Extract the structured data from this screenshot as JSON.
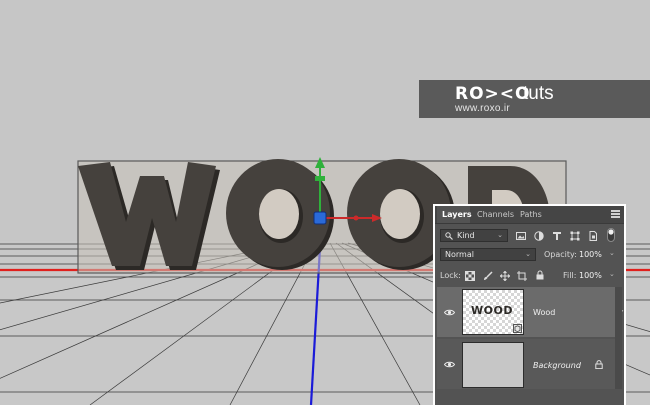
{
  "watermark": {
    "logo": "RO><O",
    "tuts": "tuts",
    "url": "www.roxo.ir"
  },
  "scene": {
    "text_3d": "WOOD",
    "text_color": "#3e3a37",
    "ground_line_color": "#e0201c",
    "axis_x_color": "#cc2a2a",
    "axis_y_color": "#2fb13b",
    "axis_z_color": "#1b1bd8"
  },
  "panel": {
    "tabs": [
      "Layers",
      "Channels",
      "Paths"
    ],
    "filter": {
      "label": "Kind"
    },
    "blend_mode": "Normal",
    "opacity_label": "Opacity:",
    "opacity_value": "100%",
    "lock_label": "Lock:",
    "fill_label": "Fill:",
    "fill_value": "100%",
    "layers": [
      {
        "name": "Wood",
        "thumb_text": "WOOD",
        "selected": true
      },
      {
        "name": "Background",
        "locked": true
      }
    ]
  }
}
